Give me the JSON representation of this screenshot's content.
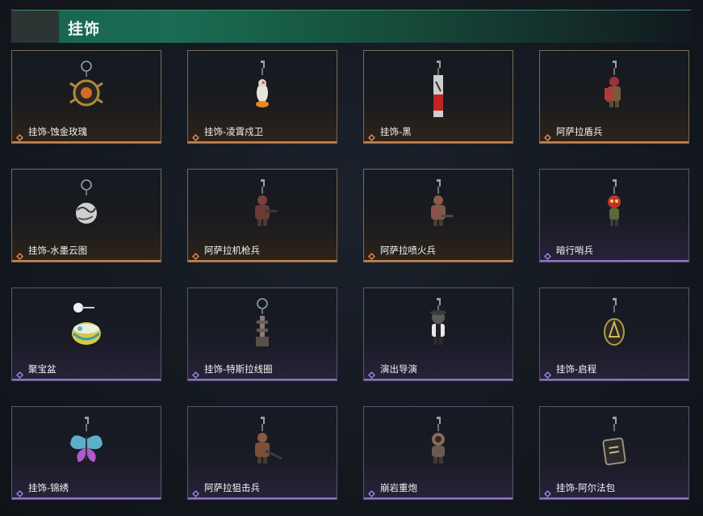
{
  "header": {
    "title": "挂饰"
  },
  "rarity_colors": {
    "gold": "#d9844a",
    "purple": "#9a7ed6"
  },
  "items": [
    {
      "name": "挂饰-蚀金玫瑰",
      "rarity": "gold",
      "icon": "rose-medallion-icon"
    },
    {
      "name": "挂饰-凌霄戍卫",
      "rarity": "gold",
      "icon": "bird-guardian-icon"
    },
    {
      "name": "挂饰-黑",
      "rarity": "gold",
      "icon": "blade-tag-icon"
    },
    {
      "name": "阿萨拉盾兵",
      "rarity": "gold",
      "icon": "shield-soldier-icon"
    },
    {
      "name": "挂饰-水墨云图",
      "rarity": "gold",
      "icon": "ink-sphere-icon"
    },
    {
      "name": "阿萨拉机枪兵",
      "rarity": "gold",
      "icon": "gunner-figure-icon"
    },
    {
      "name": "阿萨拉喷火兵",
      "rarity": "gold",
      "icon": "flamethrower-figure-icon"
    },
    {
      "name": "暗行哨兵",
      "rarity": "purple",
      "icon": "sentinel-figure-icon"
    },
    {
      "name": "聚宝盆",
      "rarity": "purple",
      "icon": "treasure-bowl-icon"
    },
    {
      "name": "挂饰-特斯拉线圈",
      "rarity": "purple",
      "icon": "tesla-coil-icon"
    },
    {
      "name": "演出导演",
      "rarity": "purple",
      "icon": "director-figure-icon"
    },
    {
      "name": "挂饰-启程",
      "rarity": "purple",
      "icon": "compass-badge-icon"
    },
    {
      "name": "挂饰-锦绣",
      "rarity": "purple",
      "icon": "butterfly-icon"
    },
    {
      "name": "阿萨拉狙击兵",
      "rarity": "purple",
      "icon": "sniper-figure-icon"
    },
    {
      "name": "崩岩重炮",
      "rarity": "purple",
      "icon": "heavy-cannon-figure-icon"
    },
    {
      "name": "挂饰-阿尔法包",
      "rarity": "purple",
      "icon": "alpha-bag-icon"
    }
  ]
}
